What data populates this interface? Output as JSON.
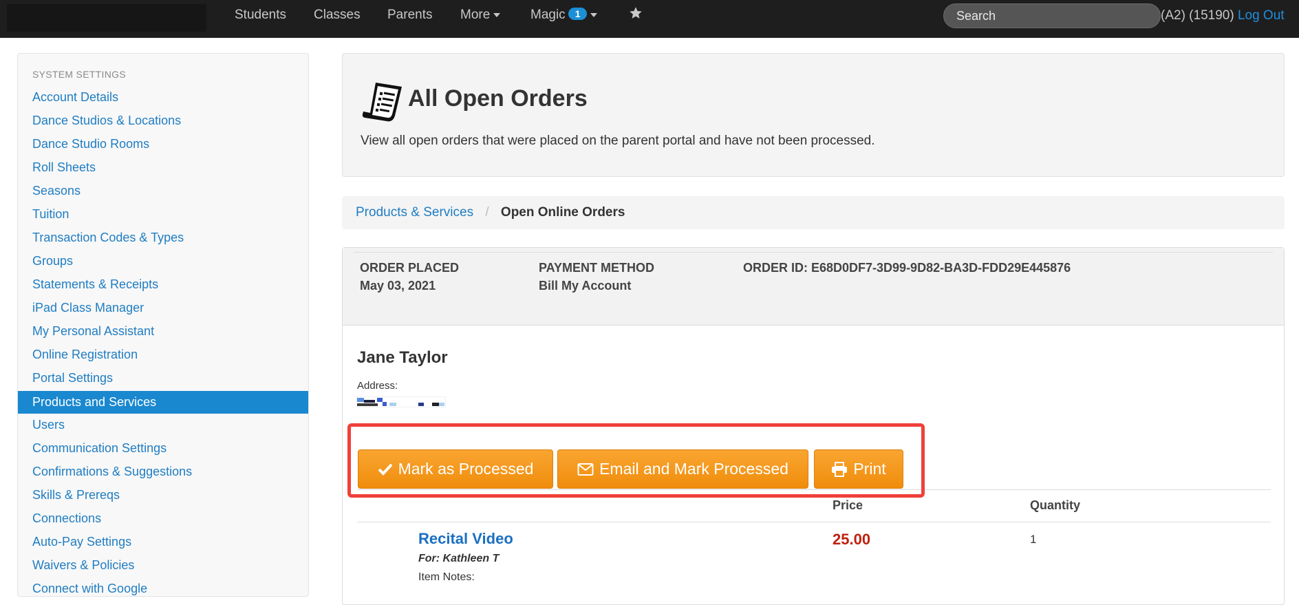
{
  "navbar": {
    "links": [
      "Students",
      "Classes",
      "Parents",
      "More",
      "Magic"
    ],
    "magic_badge": "1",
    "search_placeholder": "Search",
    "user_info": "(A2) (15190)",
    "logout": "Log Out"
  },
  "sidebar": {
    "header": "SYSTEM SETTINGS",
    "items": [
      {
        "label": "Account Details"
      },
      {
        "label": "Dance Studios & Locations"
      },
      {
        "label": "Dance Studio Rooms"
      },
      {
        "label": "Roll Sheets"
      },
      {
        "label": "Seasons"
      },
      {
        "label": "Tuition"
      },
      {
        "label": "Transaction Codes & Types"
      },
      {
        "label": "Groups"
      },
      {
        "label": "Statements & Receipts"
      },
      {
        "label": "iPad Class Manager"
      },
      {
        "label": "My Personal Assistant"
      },
      {
        "label": "Online Registration"
      },
      {
        "label": "Portal Settings"
      },
      {
        "label": "Products and Services",
        "active": true
      },
      {
        "label": "Users"
      },
      {
        "label": "Communication Settings"
      },
      {
        "label": "Confirmations & Suggestions"
      },
      {
        "label": "Skills & Prereqs"
      },
      {
        "label": "Connections"
      },
      {
        "label": "Auto-Pay Settings"
      },
      {
        "label": "Waivers & Policies"
      },
      {
        "label": "Connect with Google"
      }
    ]
  },
  "header": {
    "title": "All Open Orders",
    "description": "View all open orders that were placed on the parent portal and have not been processed."
  },
  "breadcrumb": {
    "parent": "Products & Services",
    "current": "Open Online Orders"
  },
  "order": {
    "placed_label": "ORDER PLACED",
    "placed_value": "May 03, 2021",
    "payment_label": "PAYMENT METHOD",
    "payment_value": "Bill My Account",
    "order_id": "ORDER ID: E68D0DF7-3D99-9D82-BA3D-FDD29E445876",
    "customer_name": "Jane Taylor",
    "address_label": "Address:",
    "buttons": {
      "mark_processed": "Mark as Processed",
      "email_mark": "Email and Mark Processed",
      "print": "Print"
    },
    "columns": {
      "price": "Price",
      "quantity": "Quantity"
    },
    "items": [
      {
        "name": "Recital Video",
        "for": "For: Kathleen T",
        "notes": "Item Notes:",
        "price": "25.00",
        "quantity": "1"
      }
    ]
  },
  "colors": {
    "accent": "#1a88cf",
    "button": "#f49a1e",
    "highlight": "#f0403a",
    "price": "#c0200f"
  }
}
